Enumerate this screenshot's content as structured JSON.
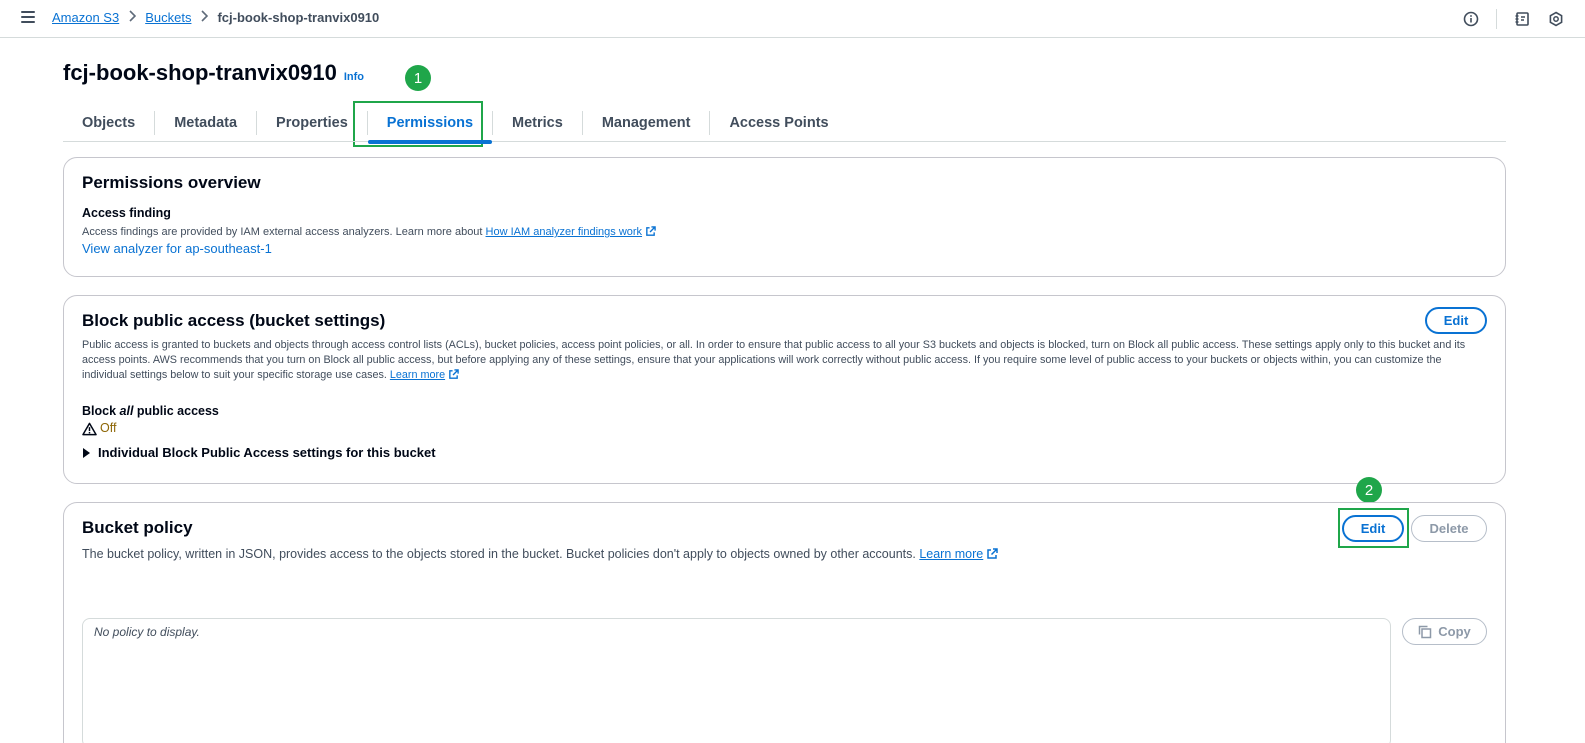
{
  "breadcrumbs": [
    {
      "label": "Amazon S3"
    },
    {
      "label": "Buckets"
    },
    {
      "label": "fcj-book-shop-tranvix0910"
    }
  ],
  "page": {
    "title": "fcj-book-shop-tranvix0910",
    "info": "Info"
  },
  "steps": {
    "one": "1",
    "two": "2"
  },
  "tabs": [
    {
      "label": "Objects"
    },
    {
      "label": "Metadata"
    },
    {
      "label": "Properties"
    },
    {
      "label": "Permissions"
    },
    {
      "label": "Metrics"
    },
    {
      "label": "Management"
    },
    {
      "label": "Access Points"
    }
  ],
  "permissions_overview": {
    "title": "Permissions overview",
    "access_finding_label": "Access finding",
    "description": "Access findings are provided by IAM external access analyzers. Learn more about ",
    "learn_link": "How IAM analyzer findings work",
    "view_analyzer": "View analyzer for ap-southeast-1"
  },
  "block_public_access": {
    "title": "Block public access (bucket settings)",
    "edit": "Edit",
    "description": "Public access is granted to buckets and objects through access control lists (ACLs), bucket policies, access point policies, or all. In order to ensure that public access to all your S3 buckets and objects is blocked, turn on Block all public access. These settings apply only to this bucket and its access points. AWS recommends that you turn on Block all public access, but before applying any of these settings, ensure that your applications will work correctly without public access. If you require some level of public access to your buckets or objects within, you can customize the individual settings below to suit your specific storage use cases.",
    "learn_more": "Learn more",
    "block_label_pre": "Block ",
    "block_label_em": "all",
    "block_label_post": " public access",
    "status": "Off",
    "expander": "Individual Block Public Access settings for this bucket"
  },
  "bucket_policy": {
    "title": "Bucket policy",
    "edit": "Edit",
    "delete": "Delete",
    "description": "The bucket policy, written in JSON, provides access to the objects stored in the bucket. Bucket policies don't apply to objects owned by other accounts. ",
    "learn_more": "Learn more",
    "empty": "No policy to display.",
    "copy": "Copy"
  },
  "colors": {
    "accent": "#0972d3",
    "annotation": "#1fa64a",
    "warning": "#8d6605"
  }
}
